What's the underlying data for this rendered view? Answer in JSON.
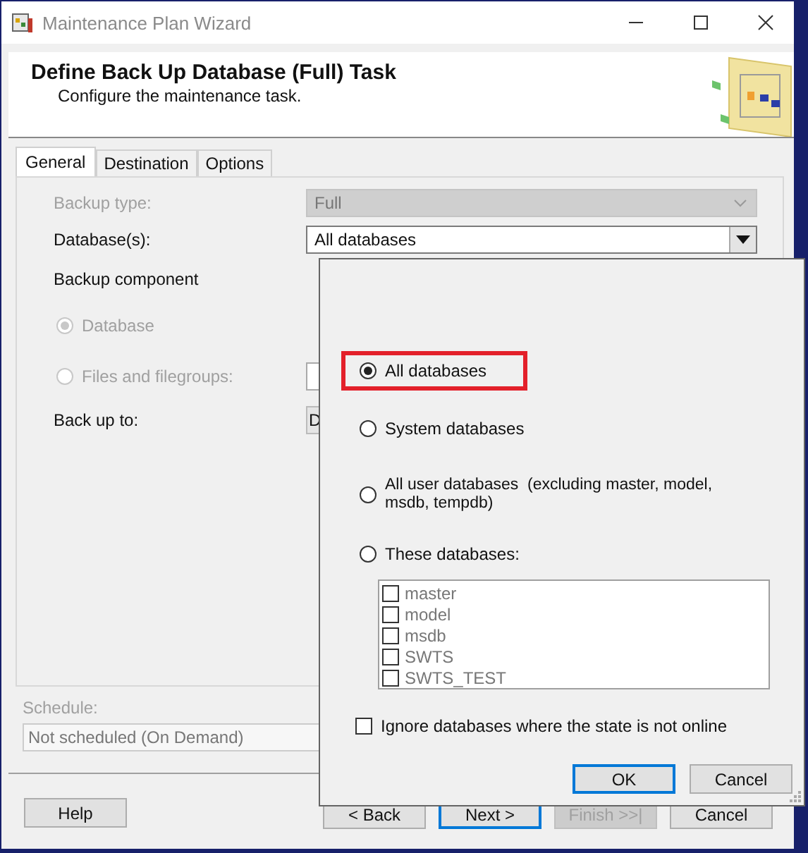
{
  "window": {
    "title": "Maintenance Plan Wizard"
  },
  "header": {
    "title": "Define Back Up Database (Full) Task",
    "subtitle": "Configure the maintenance task."
  },
  "tabs": [
    {
      "label": "General",
      "selected": true
    },
    {
      "label": "Destination",
      "selected": false
    },
    {
      "label": "Options",
      "selected": false
    }
  ],
  "form": {
    "backup_type": {
      "label": "Backup type:",
      "value": "Full",
      "disabled": true
    },
    "databases": {
      "label": "Database(s):",
      "value": "All databases"
    },
    "backup_component": {
      "label": "Backup component",
      "options": [
        {
          "label": "Database",
          "selected": true,
          "disabled": true
        },
        {
          "label": "Files and filegroups:",
          "selected": false,
          "disabled": true
        }
      ]
    },
    "back_up_to": {
      "label": "Back up to:",
      "value": "D"
    }
  },
  "schedule": {
    "label": "Schedule:",
    "value": "Not scheduled (On Demand)",
    "disabled": true
  },
  "help_button": "Help",
  "nav_buttons": [
    {
      "label": "< Back",
      "default": false,
      "disabled": false
    },
    {
      "label": "Next >",
      "default": true,
      "disabled": false
    },
    {
      "label": "Finish >>|",
      "default": false,
      "disabled": true
    },
    {
      "label": "Cancel",
      "default": false,
      "disabled": false
    }
  ],
  "popup": {
    "options": [
      {
        "label": "All databases",
        "selected": true,
        "highlighted": true
      },
      {
        "label": "System databases",
        "selected": false,
        "highlighted": false
      },
      {
        "label": "All user databases  (excluding master, model, msdb, tempdb)",
        "selected": false,
        "highlighted": false
      },
      {
        "label": "These databases:",
        "selected": false,
        "highlighted": false
      }
    ],
    "database_list": [
      {
        "name": "master",
        "checked": false
      },
      {
        "name": "model",
        "checked": false
      },
      {
        "name": "msdb",
        "checked": false
      },
      {
        "name": "SWTS",
        "checked": false
      },
      {
        "name": "SWTS_TEST",
        "checked": false
      }
    ],
    "ignore_offline": {
      "label": "Ignore databases where the state is not online",
      "checked": false
    },
    "buttons": [
      {
        "label": "OK",
        "default": true
      },
      {
        "label": "Cancel",
        "default": false
      }
    ]
  }
}
